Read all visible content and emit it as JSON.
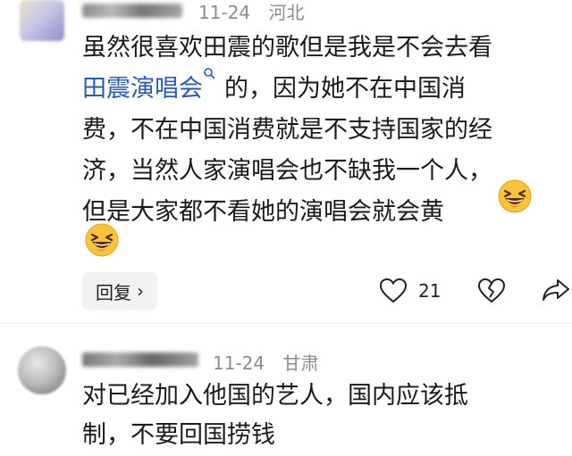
{
  "comment1": {
    "date": "11-24",
    "location": "河北",
    "lines": [
      "虽然很喜欢田震的歌但是我是不会去看",
      "的，因为她不在中国消",
      "费，不在中国消费就是不支持国家的经",
      "济，当然人家演唱会也不缺我一个人，",
      "但是大家都不看她的演唱会就会黄"
    ],
    "topic_link": "田震演唱会",
    "reply_label": "回复",
    "like_count": "21"
  },
  "comment2": {
    "date": "11-24",
    "location": "甘肃",
    "lines": [
      "对已经加入他国的艺人，国内应该抵",
      "制，不要回国捞钱"
    ]
  },
  "icons": {
    "search": "search-icon",
    "emoji": "grinning-squinting-face-icon",
    "like": "heart-icon",
    "dislike": "broken-heart-icon",
    "share": "share-icon"
  }
}
